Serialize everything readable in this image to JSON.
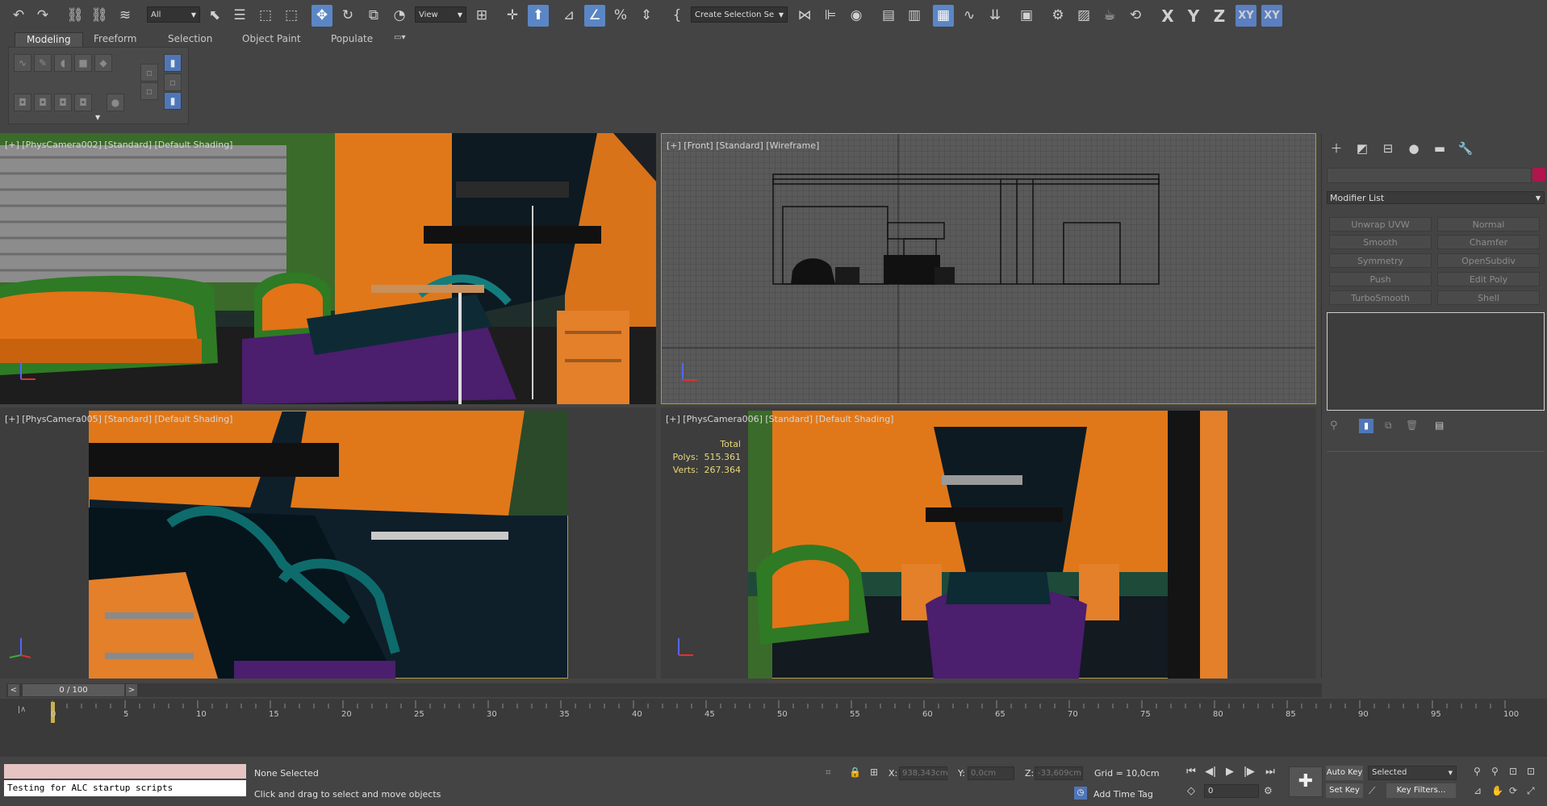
{
  "toolbar": {
    "selection_filter": "All",
    "ref_coord": "View",
    "named_selection": "Create Selection Se",
    "axis_x": "X",
    "axis_y": "Y",
    "axis_z": "Z",
    "axis_xy": "XY",
    "axis_xy2": "XY"
  },
  "ribbon": {
    "tabs": [
      "Modeling",
      "Freeform",
      "Selection",
      "Object Paint",
      "Populate"
    ]
  },
  "viewports": {
    "top_left_label": "[+] [PhysCamera002] [Standard] [Default Shading]",
    "top_right_label": "[+] [Front] [Standard] [Wireframe]",
    "bottom_left_label": "[+] [PhysCamera005] [Standard] [Default Shading]",
    "bottom_right_label": "[+] [PhysCamera006] [Standard] [Default Shading]",
    "stats_total": "Total",
    "stats_polys_label": "Polys:",
    "stats_polys_value": "515.361",
    "stats_verts_label": "Verts:",
    "stats_verts_value": "267.364"
  },
  "command_panel": {
    "modifier_list": "Modifier List",
    "buttons": [
      "Unwrap UVW",
      "Normal",
      "Smooth",
      "Chamfer",
      "Symmetry",
      "OpenSubdiv",
      "Push",
      "Edit Poly",
      "TurboSmooth",
      "Shell"
    ],
    "accent_color": "#b0154d"
  },
  "timeline": {
    "frame_counter": "0 / 100",
    "prev": "<",
    "next": ">",
    "ticks": [
      "0",
      "5",
      "10",
      "15",
      "20",
      "25",
      "30",
      "35",
      "40",
      "45",
      "50",
      "55",
      "60",
      "65",
      "70",
      "75",
      "80",
      "85",
      "90",
      "95",
      "100"
    ]
  },
  "status": {
    "script_prompt": "Testing for ALC startup scripts",
    "selection_status": "None Selected",
    "hint": "Click and drag to select and move objects",
    "x_label": "X:",
    "x_value": "938,343cm",
    "y_label": "Y:",
    "y_value": "0,0cm",
    "z_label": "Z:",
    "z_value": "-33,609cm",
    "grid": "Grid = 10,0cm",
    "add_time_tag": "Add Time Tag",
    "auto_key": "Auto Key",
    "set_key": "Set Key",
    "key_mode": "Selected",
    "key_filters": "Key Filters...",
    "current_frame": "0"
  }
}
